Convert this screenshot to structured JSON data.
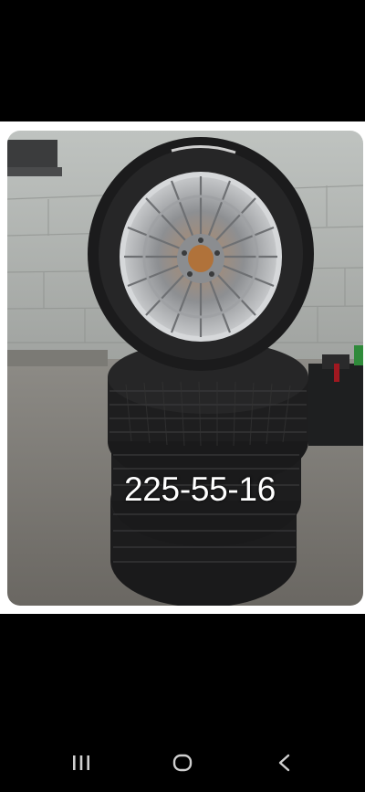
{
  "listing": {
    "tire_size_overlay": "225-55-16"
  },
  "navigation_bar": {
    "recent_apps_icon": "recent-apps-icon",
    "home_icon": "home-icon",
    "back_icon": "back-icon"
  },
  "colors": {
    "background": "#000000",
    "frame": "#ffffff",
    "overlay_text": "#ffffff",
    "nav_icon": "#cfcfcf"
  }
}
